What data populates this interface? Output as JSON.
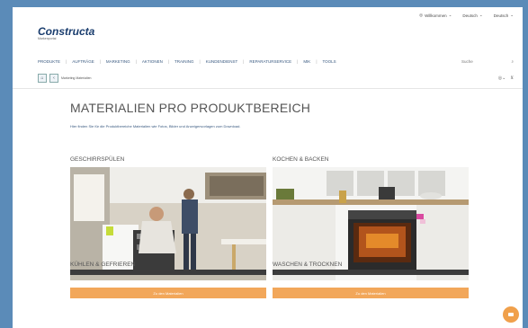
{
  "header": {
    "welcome": "Willkommen",
    "language": "Deutsch",
    "settings": "Deutsch",
    "logo": "Constructa",
    "logo_sub": "Markenportal"
  },
  "nav": {
    "items": [
      "PRODUKTE",
      "AUFTRÄGE",
      "MARKETING",
      "AKTIONEN",
      "TRAINING",
      "KUNDENDIENST",
      "REPARATURSERVICE",
      "MIK",
      "TOOLS"
    ],
    "search_placeholder": "Suche"
  },
  "toolbar": {
    "breadcrumb": "Marketing Materialien"
  },
  "page": {
    "title": "MATERIALIEN PRO PRODUKTBEREICH",
    "intro": "Hier finden Sie für die Produktbereiche Materialien wie Fotos, Bilder und Anzeigenvorlagen zum Download."
  },
  "categories": [
    {
      "title": "GESCHIRRSPÜLEN",
      "button": "Zu den Materialien"
    },
    {
      "title": "KOCHEN & BACKEN",
      "button": "Zu den Materialien"
    },
    {
      "title": "KÜHLEN & GEFRIEREN"
    },
    {
      "title": "WASCHEN & TROCKNEN"
    }
  ],
  "colors": {
    "accent": "#f2a75a",
    "brand": "#1a3d6e",
    "bezel": "#5b8bb8"
  }
}
